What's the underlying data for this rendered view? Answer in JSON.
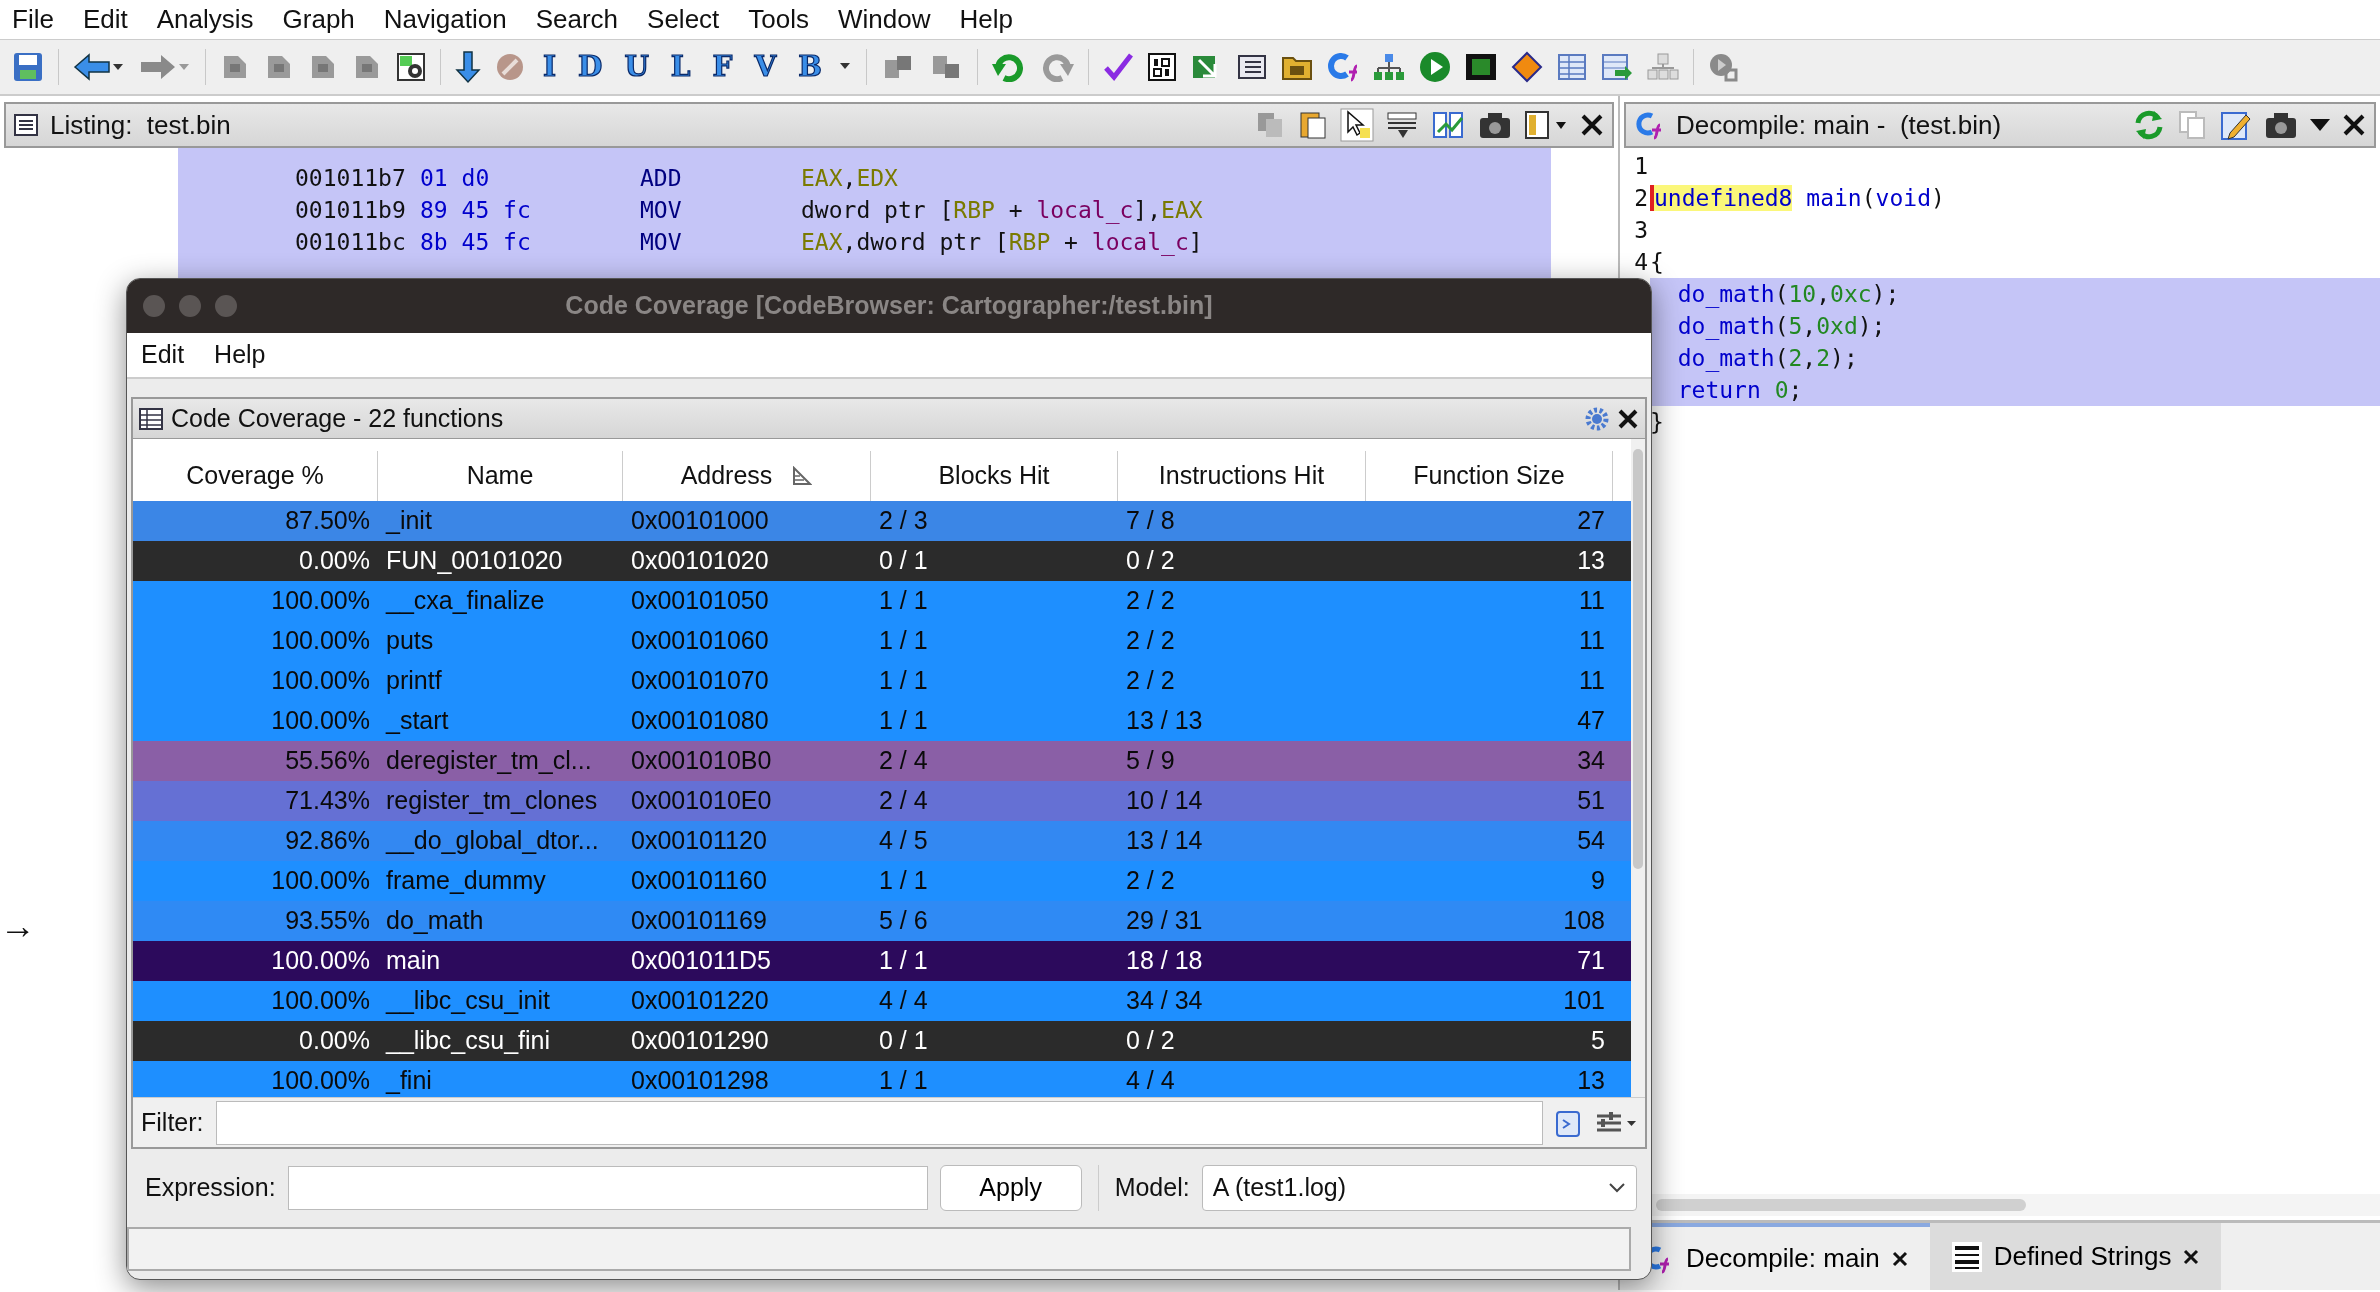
{
  "menu": [
    "File",
    "Edit",
    "Analysis",
    "Graph",
    "Navigation",
    "Search",
    "Select",
    "Tools",
    "Window",
    "Help"
  ],
  "toolbar": {
    "letter_buttons": [
      "I",
      "D",
      "U",
      "L",
      "F",
      "V",
      "B"
    ]
  },
  "listing": {
    "title": "Listing:  test.bin",
    "rows": [
      {
        "address": "001011b7",
        "bytes": "01 d0",
        "mnemonic": "ADD",
        "operands": [
          {
            "kind": "reg",
            "text": "EAX"
          },
          {
            "kind": "plain",
            "text": ","
          },
          {
            "kind": "reg",
            "text": "EDX"
          }
        ]
      },
      {
        "address": "001011b9",
        "bytes": "89 45 fc",
        "mnemonic": "MOV",
        "operands": [
          {
            "kind": "plain",
            "text": "dword ptr ["
          },
          {
            "kind": "reg",
            "text": "RBP"
          },
          {
            "kind": "plain",
            "text": " + "
          },
          {
            "kind": "var",
            "text": "local_c"
          },
          {
            "kind": "plain",
            "text": "],"
          },
          {
            "kind": "reg",
            "text": "EAX"
          }
        ]
      },
      {
        "address": "001011bc",
        "bytes": "8b 45 fc",
        "mnemonic": "MOV",
        "operands": [
          {
            "kind": "reg",
            "text": "EAX"
          },
          {
            "kind": "plain",
            "text": ",dword ptr ["
          },
          {
            "kind": "reg",
            "text": "RBP"
          },
          {
            "kind": "plain",
            "text": " + "
          },
          {
            "kind": "var",
            "text": "local_c"
          },
          {
            "kind": "plain",
            "text": "]"
          }
        ]
      }
    ],
    "margin_arrow": "→"
  },
  "decompile": {
    "title": "Decompile: main -  (test.bin)",
    "lines": [
      {
        "number": "1",
        "selected": false
      },
      {
        "number": "2",
        "selected": false,
        "tokens": [
          {
            "kind": "name",
            "text": "undefined8",
            "highlighted": true
          },
          {
            "kind": "name",
            "text": " main",
            "highlighted": false
          },
          {
            "kind": "plain",
            "text": "("
          },
          {
            "kind": "name",
            "text": "void"
          },
          {
            "kind": "plain",
            "text": ")"
          }
        ]
      },
      {
        "number": "3",
        "selected": false
      },
      {
        "number": "4",
        "selected": false,
        "tokens": [
          {
            "kind": "plain",
            "text": "{"
          }
        ],
        "children": [
          {
            "selected": true,
            "tokens": [
              {
                "kind": "name",
                "text": "do_math"
              },
              {
                "kind": "plain",
                "text": "("
              },
              {
                "kind": "num",
                "text": "10"
              },
              {
                "kind": "plain",
                "text": ","
              },
              {
                "kind": "num",
                "text": "0xc"
              },
              {
                "kind": "plain",
                "text": ");"
              }
            ]
          },
          {
            "selected": true,
            "tokens": [
              {
                "kind": "name",
                "text": "do_math"
              },
              {
                "kind": "plain",
                "text": "("
              },
              {
                "kind": "num",
                "text": "5"
              },
              {
                "kind": "plain",
                "text": ","
              },
              {
                "kind": "num",
                "text": "0xd"
              },
              {
                "kind": "plain",
                "text": ");"
              }
            ]
          },
          {
            "selected": true,
            "tokens": [
              {
                "kind": "name",
                "text": "do_math"
              },
              {
                "kind": "plain",
                "text": "("
              },
              {
                "kind": "num",
                "text": "2"
              },
              {
                "kind": "plain",
                "text": ","
              },
              {
                "kind": "num",
                "text": "2"
              },
              {
                "kind": "plain",
                "text": ");"
              }
            ]
          },
          {
            "selected": true,
            "tokens": [
              {
                "kind": "name",
                "text": "return"
              },
              {
                "kind": "num",
                "text": " 0"
              },
              {
                "kind": "plain",
                "text": ";"
              }
            ]
          }
        ]
      },
      {
        "selected": false,
        "tokens": [
          {
            "kind": "plain",
            "text": "}"
          }
        ]
      }
    ]
  },
  "bottom_tabs": [
    {
      "label": "Decompile: main",
      "selected": true
    },
    {
      "label": "Defined Strings",
      "selected": false
    }
  ],
  "coverage_window": {
    "title": "Code Coverage [CodeBrowser: Cartographer:/test.bin]",
    "menu": [
      "Edit",
      "Help"
    ],
    "panel_title": "Code Coverage - 22 functions",
    "columns": [
      "Coverage %",
      "Name",
      "Address",
      "Blocks Hit",
      "Instructions Hit",
      "Function Size"
    ],
    "rows": [
      {
        "cells": [
          "87.50%",
          "_init",
          "0x00101000",
          "2 / 3",
          "7 / 8",
          "27"
        ],
        "color": "#3b86e6",
        "selected": false
      },
      {
        "cells": [
          "0.00%",
          "FUN_00101020",
          "0x00101020",
          "0 / 1",
          "0 / 2",
          "13"
        ],
        "color": "#2b2b2b",
        "selected": false
      },
      {
        "cells": [
          "100.00%",
          "__cxa_finalize",
          "0x00101050",
          "1 / 1",
          "2 / 2",
          "11"
        ],
        "color": "#1e8fff",
        "selected": false
      },
      {
        "cells": [
          "100.00%",
          "puts",
          "0x00101060",
          "1 / 1",
          "2 / 2",
          "11"
        ],
        "color": "#1e8fff",
        "selected": false
      },
      {
        "cells": [
          "100.00%",
          "printf",
          "0x00101070",
          "1 / 1",
          "2 / 2",
          "11"
        ],
        "color": "#1e8fff",
        "selected": false
      },
      {
        "cells": [
          "100.00%",
          "_start",
          "0x00101080",
          "1 / 1",
          "13 / 13",
          "47"
        ],
        "color": "#1e8fff",
        "selected": false
      },
      {
        "cells": [
          "55.56%",
          "deregister_tm_cl...",
          "0x001010B0",
          "2 / 4",
          "5 / 9",
          "34"
        ],
        "color": "#8a5fa6",
        "selected": false
      },
      {
        "cells": [
          "71.43%",
          "register_tm_clones",
          "0x001010E0",
          "2 / 4",
          "10 / 14",
          "51"
        ],
        "color": "#6570d4",
        "selected": false
      },
      {
        "cells": [
          "92.86%",
          "__do_global_dtor...",
          "0x00101120",
          "4 / 5",
          "13 / 14",
          "54"
        ],
        "color": "#3388f2",
        "selected": false
      },
      {
        "cells": [
          "100.00%",
          "frame_dummy",
          "0x00101160",
          "1 / 1",
          "2 / 2",
          "9"
        ],
        "color": "#1e8fff",
        "selected": false
      },
      {
        "cells": [
          "93.55%",
          "do_math",
          "0x00101169",
          "5 / 6",
          "29 / 31",
          "108"
        ],
        "color": "#2f8af4",
        "selected": false
      },
      {
        "cells": [
          "100.00%",
          "main",
          "0x001011D5",
          "1 / 1",
          "18 / 18",
          "71"
        ],
        "selected": true
      },
      {
        "cells": [
          "100.00%",
          "__libc_csu_init",
          "0x00101220",
          "4 / 4",
          "34 / 34",
          "101"
        ],
        "color": "#1e8fff",
        "selected": false
      },
      {
        "cells": [
          "0.00%",
          "__libc_csu_fini",
          "0x00101290",
          "0 / 1",
          "0 / 2",
          "5"
        ],
        "color": "#2b2b2b",
        "selected": false
      },
      {
        "cells": [
          "100.00%",
          "_fini",
          "0x00101298",
          "1 / 1",
          "4 / 4",
          "13"
        ],
        "color": "#1e8fff",
        "selected": false
      }
    ],
    "filter_label": "Filter:",
    "expression_label": "Expression:",
    "apply_button": "Apply",
    "model_label": "Model:",
    "model_value": "A (test1.log)"
  }
}
